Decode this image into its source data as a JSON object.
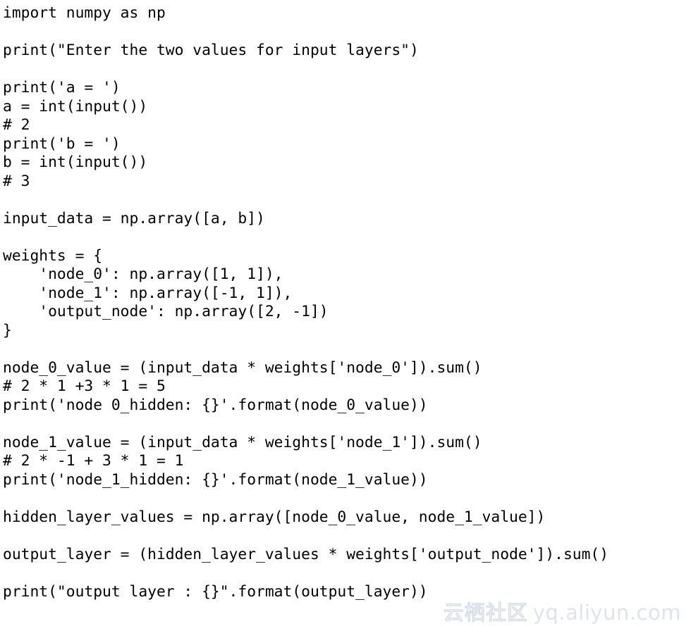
{
  "page": {
    "background_color": "#ffffff",
    "text_color": "#000000",
    "kind": "python-source-code-screenshot"
  },
  "code": {
    "language": "python",
    "lines": [
      "import numpy as np",
      "",
      "print(\"Enter the two values for input layers\")",
      "",
      "print('a = ')",
      "a = int(input())",
      "# 2",
      "print('b = ')",
      "b = int(input())",
      "# 3",
      "",
      "input_data = np.array([a, b])",
      "",
      "weights = {",
      "    'node_0': np.array([1, 1]),",
      "    'node_1': np.array([-1, 1]),",
      "    'output_node': np.array([2, -1])",
      "}",
      "",
      "node_0_value = (input_data * weights['node_0']).sum()",
      "# 2 * 1 +3 * 1 = 5",
      "print('node 0_hidden: {}'.format(node_0_value))",
      "",
      "node_1_value = (input_data * weights['node_1']).sum()",
      "# 2 * -1 + 3 * 1 = 1",
      "print('node_1_hidden: {}'.format(node_1_value))",
      "",
      "hidden_layer_values = np.array([node_0_value, node_1_value])",
      "",
      "output_layer = (hidden_layer_values * weights['output_node']).sum()",
      "",
      "print(\"output layer : {}\".format(output_layer))"
    ]
  },
  "watermark": {
    "brand_cn": "云栖社区",
    "url": "yq.aliyun.com",
    "color": "#dfe4ea"
  }
}
